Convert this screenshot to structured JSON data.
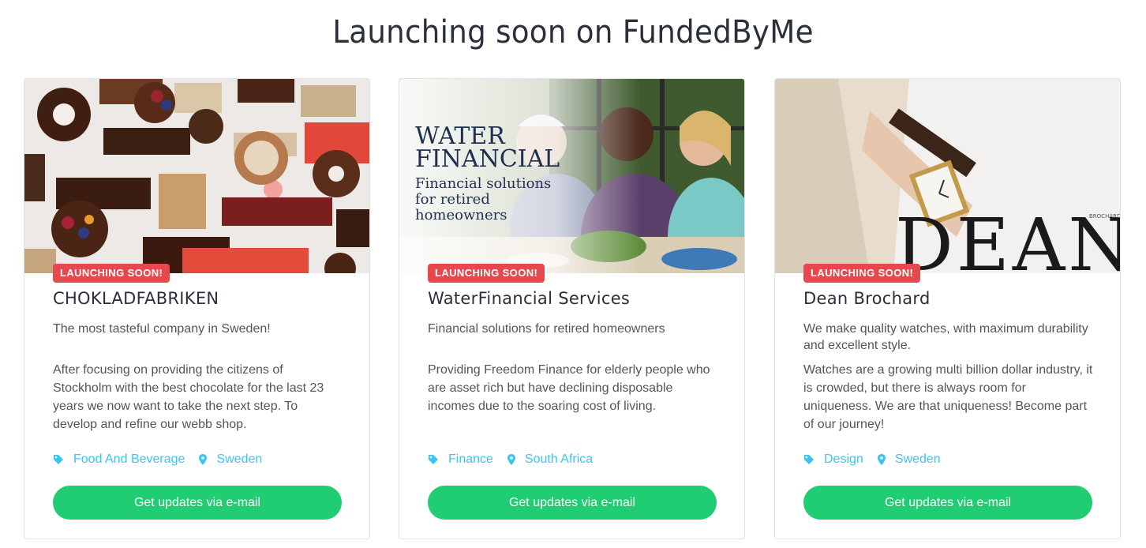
{
  "page": {
    "title": "Launching soon on FundedByMe"
  },
  "colors": {
    "badge": "#e5484d",
    "cta": "#21cd72",
    "tag": "#3cc4f0"
  },
  "cards": [
    {
      "badge": "LAUNCHING SOON!",
      "name": "CHOKLADFABRIKEN",
      "tagline": "The most tasteful company in Sweden!",
      "description": "After focusing on providing the citizens of Stockholm with the best chocolate for the last 23 years we now want to take the next step. To develop and refine our webb shop.",
      "category": "Food And Beverage",
      "location": "Sweden",
      "cta": "Get updates via e-mail"
    },
    {
      "badge": "LAUNCHING SOON!",
      "name": "WaterFinancial Services",
      "tagline": "Financial solutions for retired homeowners",
      "description": "Providing Freedom Finance for elderly people who are asset rich but have declining disposable incomes due to the soaring cost of living.",
      "category": "Finance",
      "location": "South Africa",
      "cta": "Get updates via e-mail",
      "image_text": {
        "line1": "WATER",
        "line2": "FINANCIAL",
        "line3": "Financial solutions",
        "line4": "for retired",
        "line5": "homeowners"
      }
    },
    {
      "badge": "LAUNCHING SOON!",
      "name": "Dean Brochard",
      "tagline": "We make quality watches, with maximum durability and excellent style.",
      "description": "Watches are a growing multi billion dollar industry, it is crowded, but there is always room for uniqueness. We are that uniqueness! Become part of our journey!",
      "category": "Design",
      "location": "Sweden",
      "cta": "Get updates via e-mail",
      "image_text": {
        "logo": "DEAN",
        "small": "BROCHARD"
      }
    }
  ]
}
